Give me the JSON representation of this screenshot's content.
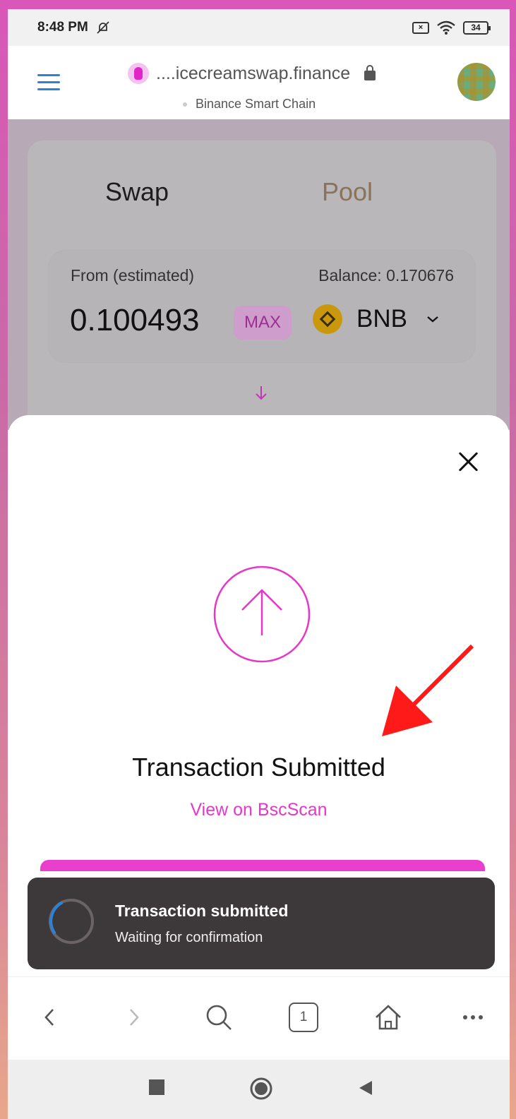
{
  "status_bar": {
    "time": "8:48 PM",
    "battery": "34"
  },
  "browser": {
    "url": "....icecreamswap.finance",
    "network": "Binance Smart Chain",
    "tab_count": "1"
  },
  "swap": {
    "tabs": {
      "swap": "Swap",
      "pool": "Pool"
    },
    "from_label": "From (estimated)",
    "balance": "Balance: 0.170676",
    "amount": "0.100493",
    "max_label": "MAX",
    "token": "BNB"
  },
  "modal": {
    "title": "Transaction Submitted",
    "link": "View on BscScan"
  },
  "toast": {
    "title": "Transaction submitted",
    "subtitle": "Waiting for confirmation"
  },
  "colors": {
    "accent": "#e637c8",
    "annotation_arrow": "#ff1a1a",
    "toast_bg": "#3d3839"
  }
}
